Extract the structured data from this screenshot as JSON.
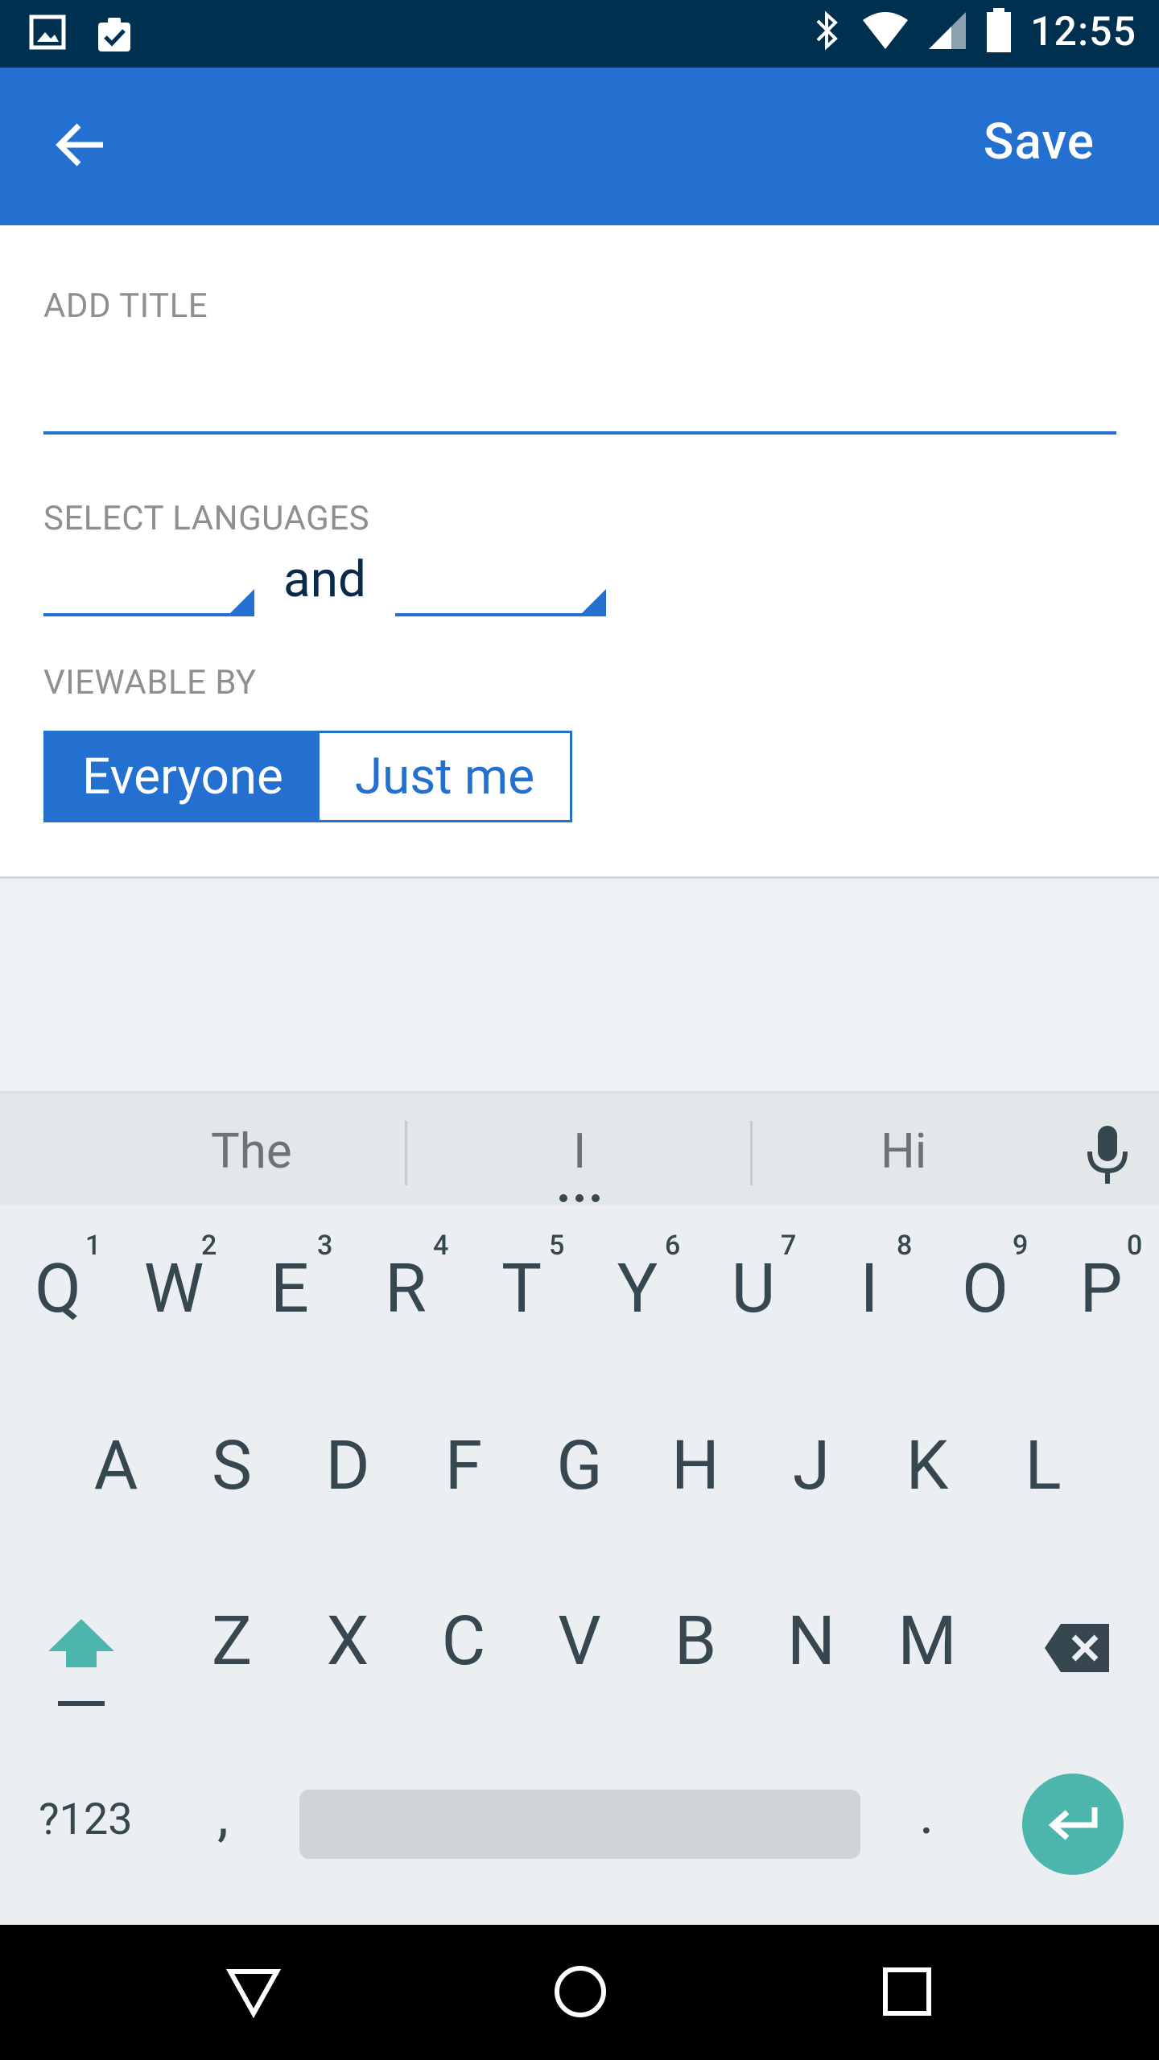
{
  "status_bar": {
    "time": "12:55"
  },
  "app_bar": {
    "save_label": "Save"
  },
  "form": {
    "title_label": "ADD TITLE",
    "title_value": "",
    "languages_label": "SELECT LANGUAGES",
    "and_text": "and",
    "viewable_label": "VIEWABLE BY",
    "viewable_options": [
      "Everyone",
      "Just me"
    ],
    "viewable_selected": "Everyone"
  },
  "keyboard": {
    "suggestions": [
      "The",
      "I",
      "Hi"
    ],
    "row1": [
      "Q",
      "W",
      "E",
      "R",
      "T",
      "Y",
      "U",
      "I",
      "O",
      "P"
    ],
    "row1_hints": [
      "1",
      "2",
      "3",
      "4",
      "5",
      "6",
      "7",
      "8",
      "9",
      "0"
    ],
    "row2": [
      "A",
      "S",
      "D",
      "F",
      "G",
      "H",
      "J",
      "K",
      "L"
    ],
    "row3": [
      "Z",
      "X",
      "C",
      "V",
      "B",
      "N",
      "M"
    ],
    "symbols_label": "?123",
    "comma": ",",
    "period": "."
  },
  "colors": {
    "primary": "#2370d0",
    "status_bar": "#003050",
    "accent": "#4db6ac"
  }
}
